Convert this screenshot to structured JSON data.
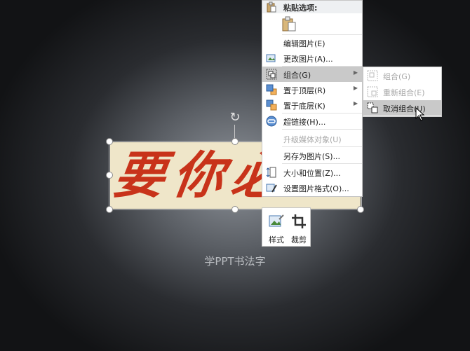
{
  "slide": {
    "calligraphy_text": "要你必",
    "caption": "学PPT书法字"
  },
  "context_menu": {
    "paste_options_label": "粘贴选项:",
    "items": [
      {
        "label": "编辑图片(E)",
        "icon": "edit-picture-icon",
        "enabled": true
      },
      {
        "label": "更改图片(A)...",
        "icon": "change-picture-icon",
        "enabled": true
      },
      {
        "label": "组合(G)",
        "icon": "group-icon",
        "enabled": true,
        "submenu": true,
        "highlighted": true
      },
      {
        "label": "置于顶层(R)",
        "icon": "bring-to-front-icon",
        "enabled": true,
        "submenu": true
      },
      {
        "label": "置于底层(K)",
        "icon": "send-to-back-icon",
        "enabled": true,
        "submenu": true
      },
      {
        "label": "超链接(H)...",
        "icon": "hyperlink-icon",
        "enabled": true
      },
      {
        "label": "升级媒体对象(U)",
        "icon": "",
        "enabled": false
      },
      {
        "label": "另存为图片(S)...",
        "icon": "",
        "enabled": true
      },
      {
        "label": "大小和位置(Z)...",
        "icon": "size-position-icon",
        "enabled": true
      },
      {
        "label": "设置图片格式(O)...",
        "icon": "format-picture-icon",
        "enabled": true
      }
    ]
  },
  "group_submenu": {
    "items": [
      {
        "label": "组合(G)",
        "enabled": false
      },
      {
        "label": "重新组合(E)",
        "enabled": false
      },
      {
        "label": "取消组合(U)",
        "enabled": true,
        "highlighted": true
      }
    ]
  },
  "mini_toolbar": {
    "style_label": "样式",
    "crop_label": "裁剪"
  },
  "colors": {
    "calligraphy": "#c8331a",
    "picture_background": "#efe6c9",
    "menu_highlight": "#c9c9c9"
  }
}
